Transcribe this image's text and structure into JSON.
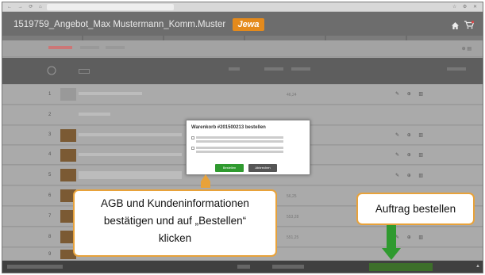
{
  "window": {
    "title": "1519759_Angebot_Max Mustermann_Komm.Muster",
    "logo_text": "Jewa",
    "brand_color": "#e48a1c"
  },
  "dialog": {
    "title": "Warenkorb #201500213 bestellen",
    "confirm_button": "Bestellen",
    "cancel_button": "Abbrechen"
  },
  "callouts": {
    "instruction": [
      "AGB und Kundeninformationen",
      "bestätigen und auf „Bestellen“",
      "klicken"
    ],
    "order": "Auftrag bestellen",
    "border_color": "#e8a23a",
    "arrow_color": "#2f9a2f"
  },
  "rows": [
    {
      "num": "1",
      "price": "46,24"
    },
    {
      "num": "2",
      "price": ""
    },
    {
      "num": "3",
      "price": ""
    },
    {
      "num": "4",
      "price": ""
    },
    {
      "num": "5",
      "price": ""
    },
    {
      "num": "6",
      "price": "56,25"
    },
    {
      "num": "7",
      "price": "553,28"
    },
    {
      "num": "8",
      "price": "551,25"
    },
    {
      "num": "9",
      "price": ""
    }
  ],
  "icons": [
    "home-icon",
    "cart-icon",
    "wrench-icon",
    "trash-icon"
  ]
}
